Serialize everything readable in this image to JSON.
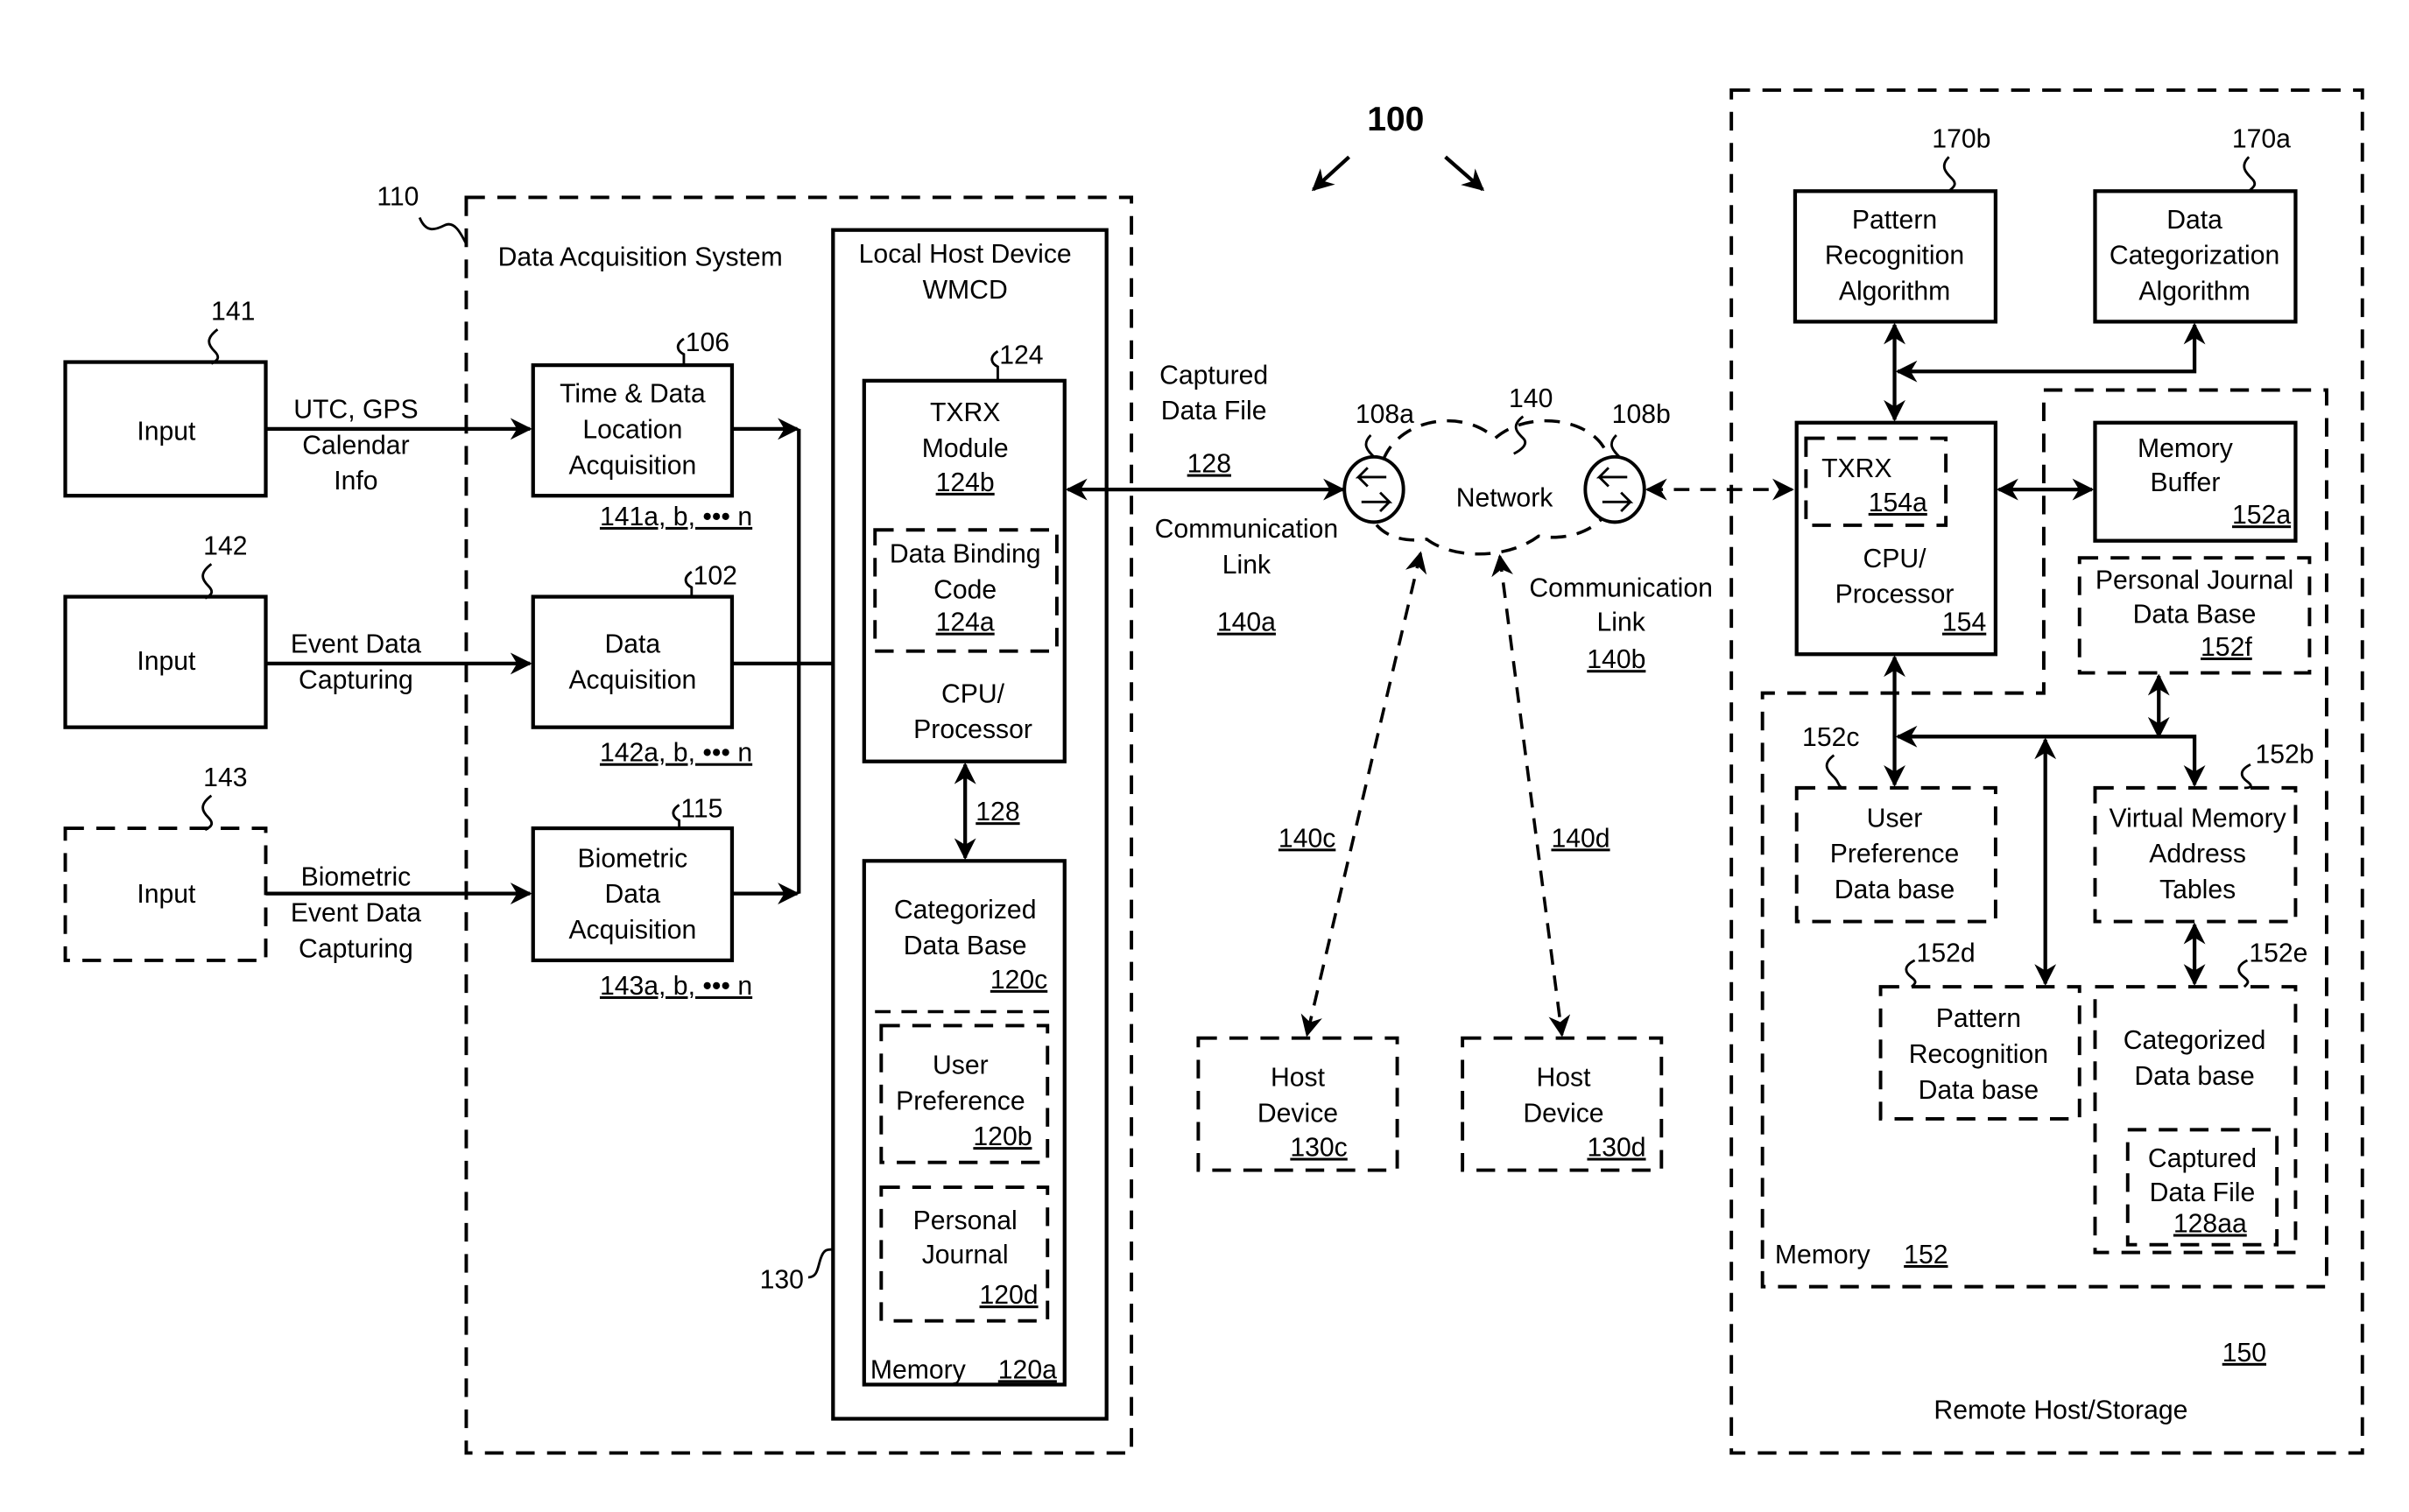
{
  "figure": {
    "ref_number": "100",
    "data_acquisition_system": {
      "ref": "110",
      "title": "Data Acquisition System",
      "inputs": [
        {
          "ref": "141",
          "label": "Input",
          "edge_label": [
            "UTC, GPS",
            "Calendar",
            "Info"
          ],
          "style": "solid"
        },
        {
          "ref": "142",
          "label": "Input",
          "edge_label": [
            "Event Data",
            "Capturing"
          ],
          "style": "solid"
        },
        {
          "ref": "143",
          "label": "Input",
          "edge_label": [
            "Biometric",
            "Event Data",
            "Capturing"
          ],
          "style": "dashed"
        }
      ],
      "modules": [
        {
          "ref": "106",
          "label": [
            "Time & Data",
            "Location",
            "Acquisition"
          ],
          "sub_ref": "141a, b, ••• n"
        },
        {
          "ref": "102",
          "label": [
            "Data",
            "Acquisition"
          ],
          "sub_ref": "142a, b, ••• n"
        },
        {
          "ref": "115",
          "label": [
            "Biometric",
            "Data",
            "Acquisition"
          ],
          "sub_ref": "143a, b, ••• n"
        }
      ]
    },
    "local_host": {
      "ref": "130",
      "title": [
        "Local Host Device",
        "WMCD"
      ],
      "txrx": {
        "ref": "124",
        "label": [
          "TXRX",
          "Module"
        ],
        "module_ref": "124b",
        "binding": {
          "label": [
            "Data Binding",
            "Code"
          ],
          "ref": "124a"
        },
        "cpu": [
          "CPU/",
          "Processor"
        ]
      },
      "bus_ref": "128",
      "memory": {
        "label": "Memory",
        "ref": "120a",
        "categorized": {
          "label": [
            "Categorized",
            "Data Base"
          ],
          "ref": "120c"
        },
        "user_pref": {
          "label": [
            "User",
            "Preference"
          ],
          "ref": "120b"
        },
        "journal": {
          "label": [
            "Personal",
            "Journal"
          ],
          "ref": "120d"
        }
      }
    },
    "links": {
      "captured": [
        "Captured",
        "Data File"
      ],
      "captured_ref": "128",
      "link_a": {
        "label": [
          "Communication",
          "Link"
        ],
        "ref": "140a"
      },
      "link_b": {
        "label": [
          "Communication",
          "Link"
        ],
        "ref": "140b"
      },
      "link_c_ref": "140c",
      "link_d_ref": "140d"
    },
    "network": {
      "label": "Network",
      "ref": "140",
      "router_a": "108a",
      "router_b": "108b"
    },
    "host_devices": [
      {
        "label": [
          "Host",
          "Device"
        ],
        "ref": "130c"
      },
      {
        "label": [
          "Host",
          "Device"
        ],
        "ref": "130d"
      }
    ],
    "remote": {
      "ref": "150",
      "title": "Remote Host/Storage",
      "pattern_algo": {
        "label": [
          "Pattern",
          "Recognition",
          "Algorithm"
        ],
        "ref": "170b"
      },
      "categ_algo": {
        "label": [
          "Data",
          "Categorization",
          "Algorithm"
        ],
        "ref": "170a"
      },
      "cpu": {
        "txrx": "TXRX",
        "txrx_ref": "154a",
        "label": [
          "CPU/",
          "Processor"
        ],
        "ref": "154"
      },
      "memory": {
        "label": "Memory",
        "ref": "152",
        "buffer": {
          "label": [
            "Memory",
            "Buffer"
          ],
          "ref": "152a"
        },
        "journal": {
          "label": [
            "Personal Journal",
            "Data Base"
          ],
          "ref": "152f"
        },
        "user_pref": {
          "label": [
            "User",
            "Preference",
            "Data base"
          ],
          "ref": "152c"
        },
        "vmat": {
          "label": [
            "Virtual Memory",
            "Address",
            "Tables"
          ],
          "ref": "152b"
        },
        "pattern_db": {
          "label": [
            "Pattern",
            "Recognition",
            "Data base"
          ],
          "ref": "152d"
        },
        "categ_db": {
          "label": [
            "Categorized",
            "Data base"
          ],
          "ref": "152e"
        },
        "captured": {
          "label": [
            "Captured",
            "Data File"
          ],
          "ref": "128aa"
        }
      }
    }
  }
}
